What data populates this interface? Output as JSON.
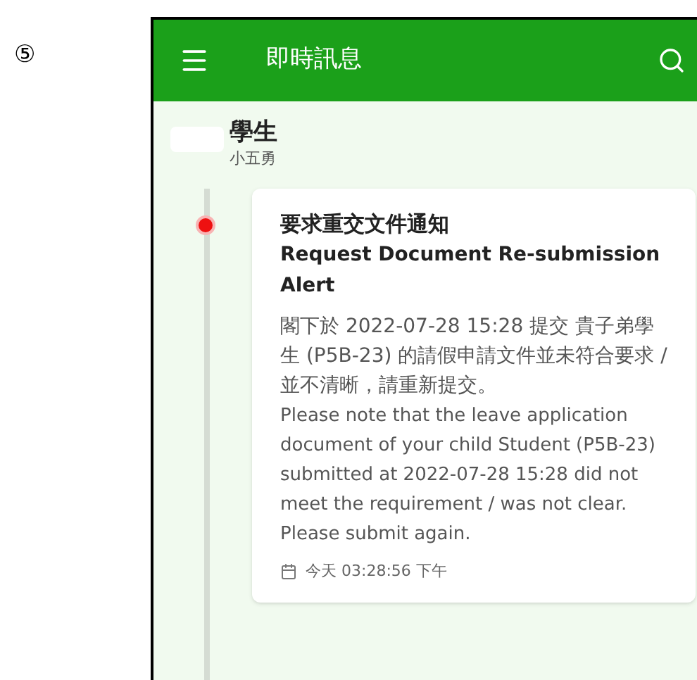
{
  "step_marker": "⑤",
  "app_bar": {
    "title": "即時訊息"
  },
  "student": {
    "name": "學生",
    "class_name": "小五勇"
  },
  "messages": [
    {
      "unread": true,
      "title": "要求重交文件通知",
      "title_en": "Request Document Re-submission Alert",
      "body_zh": "閣下於 2022-07-28 15:28 提交 貴子弟學生 (P5B-23) 的請假申請文件並未符合要求 / 並不清晰，請重新提交。",
      "body_en": "Please note that the leave application document of your child Student (P5B-23) submitted at 2022-07-28 15:28 did not meet the requirement / was not clear. Please submit again.",
      "time": "今天 03:28:56 下午"
    }
  ]
}
